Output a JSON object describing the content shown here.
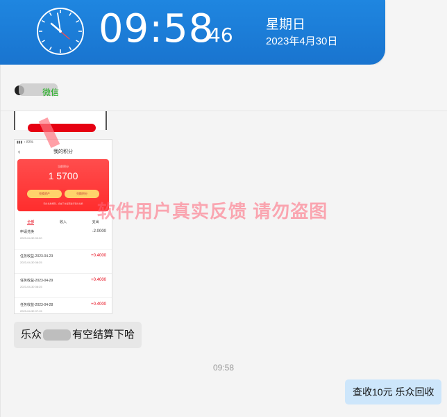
{
  "clock": {
    "time": "09:58",
    "seconds": "46",
    "weekday": "星期日",
    "date": "2023年4月30日"
  },
  "chat": {
    "contact_name": "微信",
    "watermark": "软件用户真实反馈  请勿盗图",
    "screenshot": {
      "nav_title": "我的积分",
      "points_label": "当前积分",
      "points_value": "1 5700",
      "btn_left": "兑换资产",
      "btn_right": "兑换积分",
      "card_note": "积分兑换规则，点击下方提现进行积分兑换",
      "tabs": [
        "全部",
        "收入",
        "支出"
      ],
      "rows": [
        {
          "title": "申请兑换",
          "date": "2023-04-30 09:20",
          "amount": "-2.0000"
        },
        {
          "title": "任务收益-2023-04-23",
          "date": "2023-04-30 08:25",
          "amount": "+0.4000"
        },
        {
          "title": "任务收益-2023-04-29",
          "date": "2023-04-30 08:25",
          "amount": "+0.4000"
        },
        {
          "title": "任务收益-2023-04-28",
          "date": "2023-04-30 07:15",
          "amount": "+0.4000"
        }
      ]
    },
    "incoming_msg_start": "乐众",
    "incoming_msg_end": "有空结算下哈",
    "timestamp": "09:58",
    "outgoing_msg": "查收10元 乐众回收"
  }
}
